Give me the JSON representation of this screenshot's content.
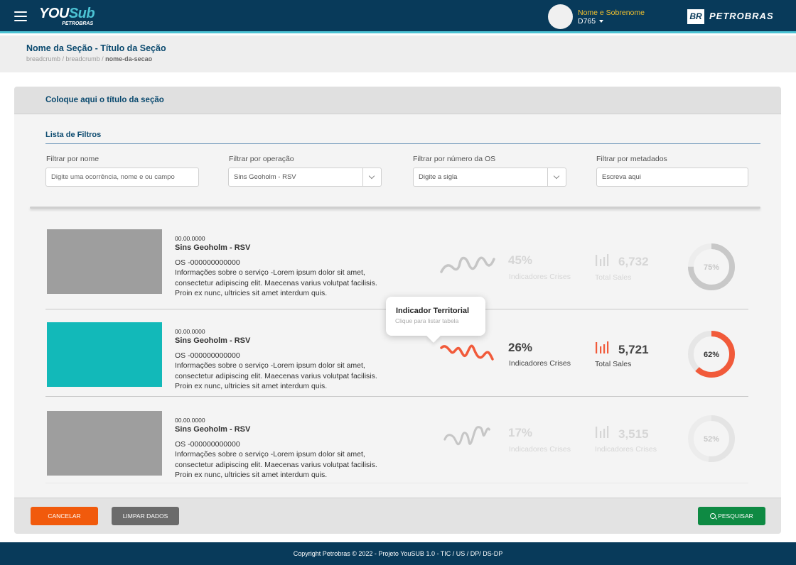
{
  "header": {
    "logo_you": "YOU",
    "logo_sub": "Sub",
    "logo_company": "PETROBRAS",
    "user_name": "Nome e Sobrenome",
    "user_id": "D765",
    "brand_mark": "BR",
    "brand_name": "PETROBRAS"
  },
  "page": {
    "title": "Nome da Seção - Título da Seção",
    "breadcrumb": [
      "breadcrumb",
      "breadcrumb",
      "nome-da-secao"
    ]
  },
  "card": {
    "title": "Coloque aqui o título da seção",
    "filters_title": "Lista de Filtros",
    "filters": [
      {
        "label": "Filtrar por nome",
        "placeholder": "Digite uma ocorrência, nome e ou campo",
        "type": "text"
      },
      {
        "label": "Filtrar por operação",
        "value": "Sins Geoholm - RSV",
        "type": "select"
      },
      {
        "label": "Filtrar por número da OS",
        "placeholder": "Digite a sigla",
        "type": "select"
      },
      {
        "label": "Filtrar por metadados",
        "placeholder": "Escreva aqui",
        "type": "text"
      }
    ]
  },
  "rows": [
    {
      "date": "00.00.0000",
      "title": "Sins Geoholm - RSV",
      "os": "OS -000000000000",
      "description": "Informações sobre o serviço -Lorem ipsum dolor sit amet, consectetur adipiscing elit. Maecenas varius volutpat facilisis. Proin ex nunc, ultricies sit amet interdum quis.",
      "stat1_value": "45%",
      "stat1_label": "Indicadores Crises",
      "stat2_value": "6,732",
      "stat2_label": "Total Sales",
      "donut_label": "75%",
      "donut_percent": 75,
      "state": "faded"
    },
    {
      "date": "00.00.0000",
      "title": "Sins Geoholm - RSV",
      "os": "OS -000000000000",
      "description": "Informações sobre o serviço -Lorem ipsum dolor sit amet, consectetur adipiscing elit. Maecenas varius volutpat facilisis. Proin ex nunc, ultricies sit amet interdum quis.",
      "stat1_value": "26%",
      "stat1_label": "Indicadores Crises",
      "stat2_value": "5,721",
      "stat2_label": "Total Sales",
      "donut_label": "62%",
      "donut_percent": 62,
      "state": "highlighted"
    },
    {
      "date": "00.00.0000",
      "title": "Sins Geoholm - RSV",
      "os": "OS -000000000000",
      "description": "Informações sobre o serviço -Lorem ipsum dolor sit amet, consectetur adipiscing elit. Maecenas varius volutpat facilisis. Proin ex nunc, ultricies sit amet interdum quis.",
      "stat1_value": "17%",
      "stat1_label": "Indicadores Crises",
      "stat2_value": "3,515",
      "stat2_label": "Indicadores Crises",
      "donut_label": "52%",
      "donut_percent": 52,
      "state": "faded"
    }
  ],
  "tooltip": {
    "title": "Indicador Territorial",
    "subtitle": "Clique para listar tabela"
  },
  "actions": {
    "cancel": "CANCELAR",
    "clear": "LIMPAR DADOS",
    "search": "PESQUISAR"
  },
  "footer": {
    "copyright": "Copyright Petrobras © 2022 - Projeto YouSUB 1.0 - TIC / US / DP/ DS-DP"
  },
  "colors": {
    "header_bg": "#083a5a",
    "accent_cyan": "#4cc3d4",
    "title_blue": "#0b4a6f",
    "highlight_orange": "#f15a3a",
    "faded_gray": "#d6d6d6",
    "cancel": "#f15a0c",
    "clear": "#6b6b6b",
    "search": "#0e8a43",
    "active_thumb": "#12b9b9"
  }
}
